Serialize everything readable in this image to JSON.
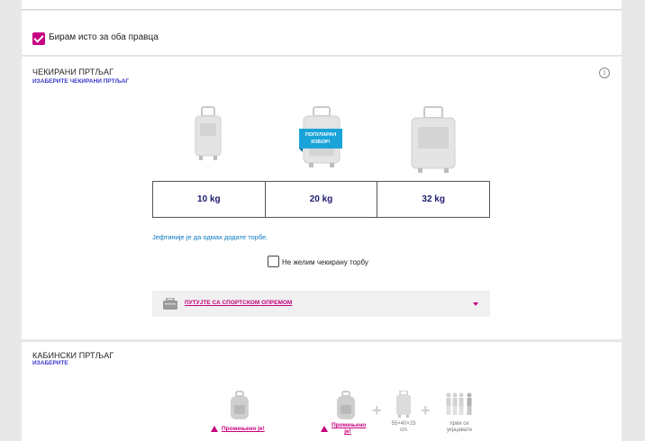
{
  "same_both_ways": {
    "label": "Бирам исто за оба правца",
    "checked": true
  },
  "checked_baggage": {
    "title": "ЧЕКИРАНИ ПРТЉАГ",
    "select_link": "ИЗАБЕРИТЕ ЧЕКИРАНИ ПРТЉАГ",
    "info_icon": "info-icon",
    "badge": [
      "ПОПУЛАРАН",
      "ИЗБОР!"
    ],
    "options": [
      "10 kg",
      "20 kg",
      "32 kg"
    ],
    "cheaper_note": "Јефтиније је да одмах додате торбе.",
    "no_bag_label": "Не желим чекирану торбу",
    "sport_label": "ПУТУЈТЕ СА СПОРТСКОМ ОПРЕМОМ"
  },
  "cabin_baggage": {
    "title": "КАБИНСКИ ПРТЉАГ",
    "select_link": "ИЗАБЕРИТЕ",
    "changed_label": "Промењено је!",
    "changed_label_lines": [
      "Промењено",
      "је!"
    ],
    "dims_lines": [
      "55×40×23",
      "cm"
    ],
    "board_lines": [
      "први се",
      "укрцавате"
    ]
  },
  "colors": {
    "accent": "#c6007e",
    "link": "#3a3acb",
    "info": "#0c7ac2",
    "badge": "#1aa3d9"
  }
}
